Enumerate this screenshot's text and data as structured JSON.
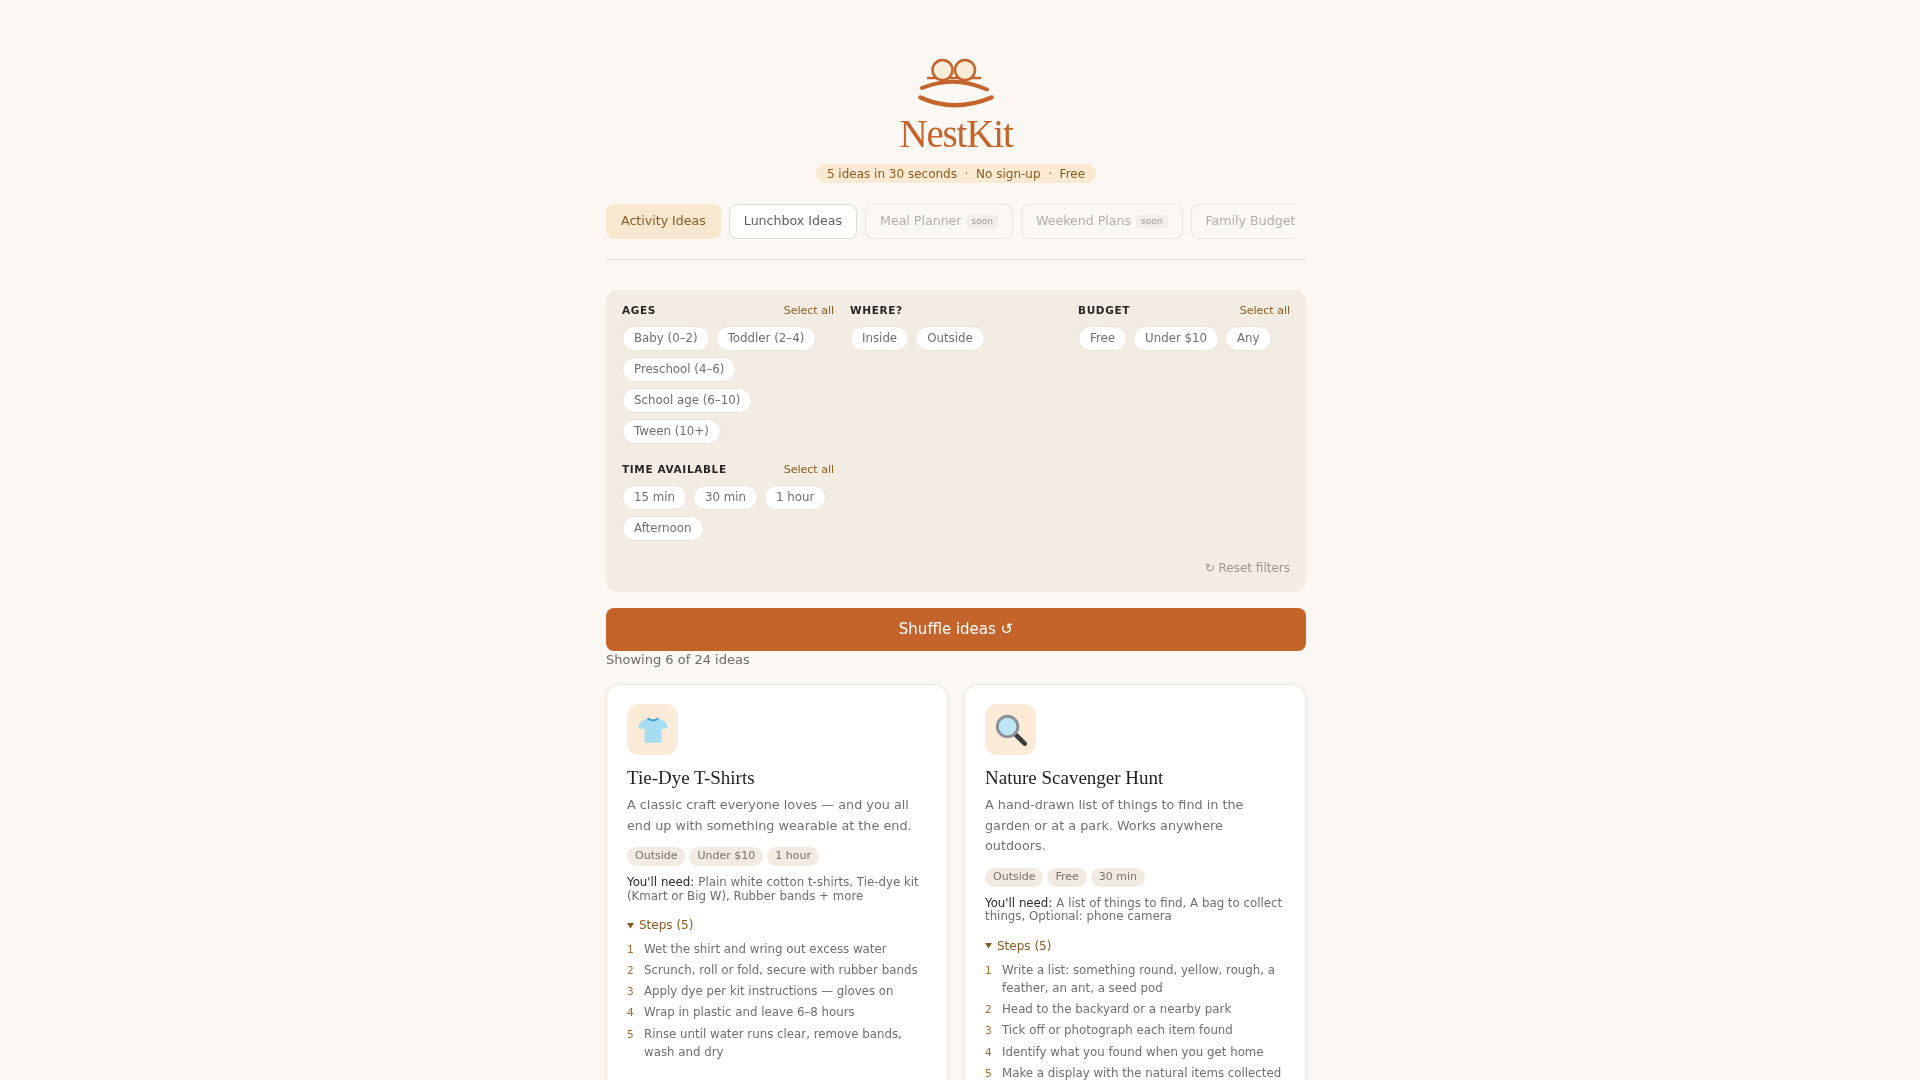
{
  "header": {
    "title": "NestKit",
    "tagline": "5 ideas in 30 seconds  ·  No sign-up  ·  Free"
  },
  "tabs": [
    {
      "label": "Activity Ideas",
      "selected": true,
      "disabled": false
    },
    {
      "label": "Lunchbox Ideas",
      "selected": false,
      "disabled": false
    },
    {
      "label": "Meal Planner",
      "selected": false,
      "disabled": true,
      "badge": "soon"
    },
    {
      "label": "Weekend Plans",
      "selected": false,
      "disabled": true,
      "badge": "soon"
    },
    {
      "label": "Family Budget",
      "selected": false,
      "disabled": true
    }
  ],
  "filters": {
    "columns": [
      [
        {
          "title": "AGES",
          "select_all": "Select all",
          "chips": [
            {
              "label": "Baby (0–2)",
              "selected": false
            },
            {
              "label": "Toddler (2–4)",
              "selected": false
            },
            {
              "label": "Preschool (4–6)",
              "selected": false
            },
            {
              "label": "School age (6–10)",
              "selected": false
            },
            {
              "label": "Tween (10+)",
              "selected": false
            }
          ]
        },
        {
          "title": "TIME AVAILABLE",
          "select_all": "Select all",
          "chips": [
            {
              "label": "15 min",
              "selected": false
            },
            {
              "label": "30 min",
              "selected": false
            },
            {
              "label": "1 hour",
              "selected": false
            },
            {
              "label": "Afternoon",
              "selected": false
            }
          ]
        }
      ],
      [
        {
          "title": "WHERE?",
          "chips": [
            {
              "label": "Inside",
              "selected": false
            },
            {
              "label": "Outside",
              "selected": false
            }
          ]
        }
      ],
      [
        {
          "title": "BUDGET",
          "select_all": "Select all",
          "chips": [
            {
              "label": "Free",
              "selected": false
            },
            {
              "label": "Under $10",
              "selected": false
            },
            {
              "label": "Any",
              "selected": false
            }
          ]
        }
      ]
    ],
    "reset": "↻ Reset filters"
  },
  "shuffle_button": "Shuffle ideas ↺",
  "results_count": "Showing 6 of 24 ideas",
  "cards": [
    {
      "kind": "tshirt",
      "title": "Tie-Dye T-Shirts",
      "description": "A classic craft everyone loves — and you all end up with something wearable at the end.",
      "tags": [
        "Outside",
        "Under $10",
        "1 hour"
      ],
      "needs_label": "You'll need:",
      "needs": "Plain white cotton t-shirts, Tie-dye kit (Kmart or Big W), Rubber bands + more",
      "steps_label": "Steps (5)",
      "steps_expanded": true,
      "steps": [
        {
          "number": "1",
          "text": "Wet the shirt and wring out excess water"
        },
        {
          "number": "2",
          "text": "Scrunch, roll or fold, secure with rubber bands"
        },
        {
          "number": "3",
          "text": "Apply dye per kit instructions — gloves on"
        },
        {
          "number": "4",
          "text": "Wrap in plastic and leave 6–8 hours"
        },
        {
          "number": "5",
          "text": "Rinse until water runs clear, remove bands, wash and dry"
        }
      ]
    },
    {
      "kind": "magnifier",
      "title": "Nature Scavenger Hunt",
      "description": "A hand-drawn list of things to find in the garden or at a park. Works anywhere outdoors.",
      "tags": [
        "Outside",
        "Free",
        "30 min"
      ],
      "needs_label": "You'll need:",
      "needs": "A list of things to find, A bag to collect things, Optional: phone camera",
      "steps_label": "Steps (5)",
      "steps_expanded": true,
      "steps": [
        {
          "number": "1",
          "text": "Write a list: something round, yellow, rough, a feather, an ant, a seed pod"
        },
        {
          "number": "2",
          "text": "Head to the backyard or a nearby park"
        },
        {
          "number": "3",
          "text": "Tick off or photograph each item found"
        },
        {
          "number": "4",
          "text": "Identify what you found when you get home"
        },
        {
          "number": "5",
          "text": "Make a display with the natural items collected"
        }
      ]
    }
  ]
}
